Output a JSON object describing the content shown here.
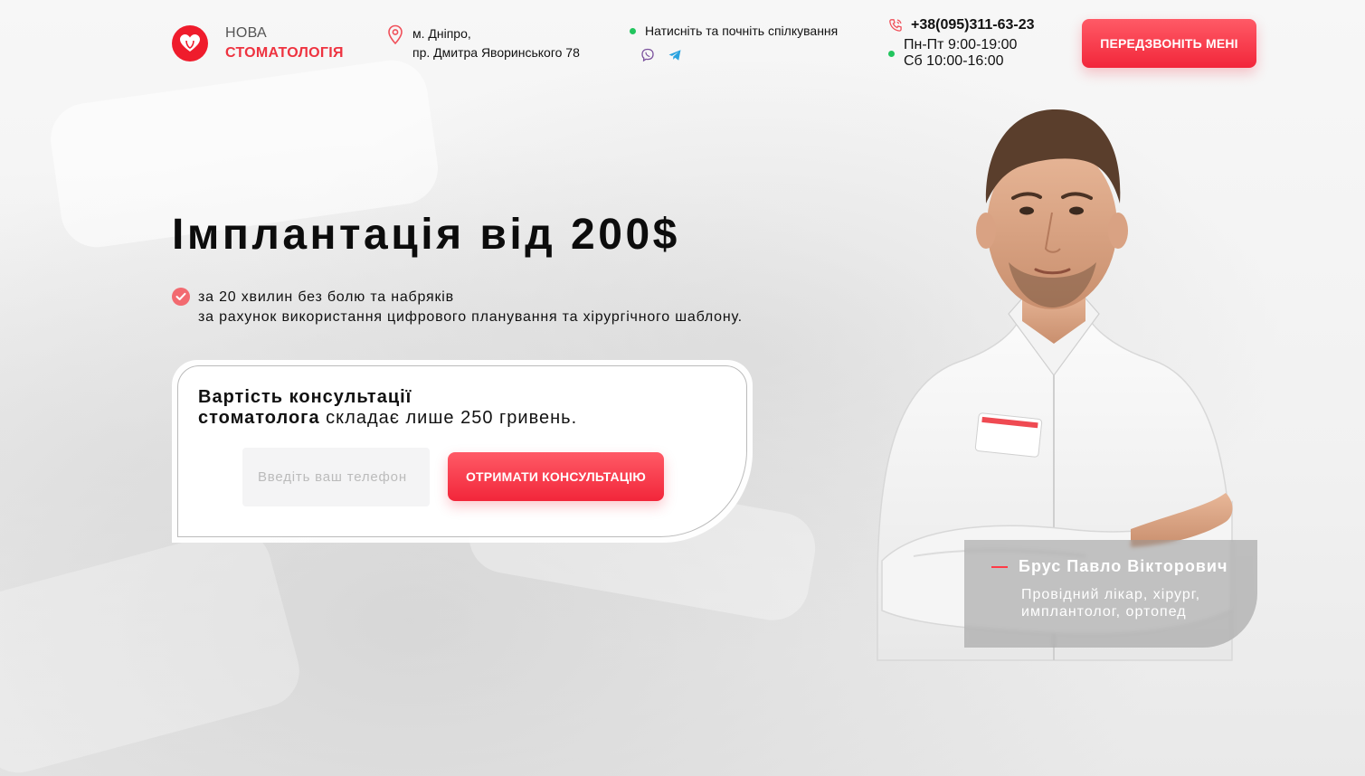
{
  "logo": {
    "line1": "НОВА",
    "line2": "СТОМАТОЛОГІЯ",
    "icon": "heart-tooth-icon",
    "color": "#ef1c2c"
  },
  "address": {
    "icon": "location-pin-icon",
    "line1": "м. Дніпро,",
    "line2": "пр. Дмитра Яворинського 78"
  },
  "messenger": {
    "prompt": "Натисніть та почніть спілкування",
    "icons": [
      "viber-icon",
      "telegram-icon"
    ]
  },
  "contacts": {
    "phone_icon": "phone-icon",
    "phone": "+38(095)311-63-23",
    "hours_weekdays": "Пн-Пт 9:00-19:00",
    "hours_saturday": "Сб 10:00-16:00"
  },
  "header_button": {
    "label": "ПЕРЕДЗВОНІТЬ МЕНІ"
  },
  "hero": {
    "title": "Імплантація від 200$",
    "benefit_line1": "за 20 хвилин без болю та набряків",
    "benefit_line2": "за рахунок використання цифрового планування та хірургічного шаблону."
  },
  "consultation": {
    "bold_line1": "Вартість консультації",
    "bold_line2": "стоматолога",
    "rest": " складає лише 250 гривень.",
    "input_placeholder": "Введіть ваш телефон",
    "button_label": "ОТРИМАТИ КОНСУЛЬТАЦІЮ"
  },
  "doctor": {
    "name": "Брус Павло Вікторович",
    "role_line1": "Провідний лікар, хірург,",
    "role_line2": "имплантолог, ортопед"
  },
  "colors": {
    "accent": "#f2263a",
    "accent_light": "#ff5a66",
    "online_dot": "#22c55e"
  }
}
